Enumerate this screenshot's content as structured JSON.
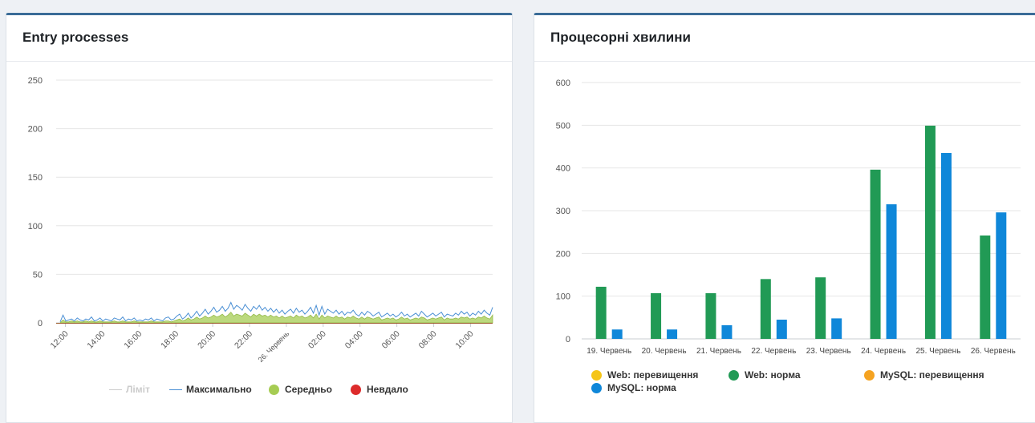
{
  "cards": {
    "left_title": "Entry processes",
    "right_title": "Процесорні хвилини"
  },
  "colors": {
    "limit": "#cccccc",
    "max": "#4a8fd4",
    "avg": "#a6cc53",
    "fail": "#dd2b2b",
    "web_over": "#f5c518",
    "web_norm": "#219a55",
    "mysql_over": "#f5a321",
    "mysql_norm": "#0f87d9"
  },
  "chart_data": [
    {
      "type": "area",
      "title": "Entry processes",
      "ylim": [
        0,
        250
      ],
      "y_ticks": [
        0,
        50,
        100,
        150,
        200,
        250
      ],
      "x_tick_labels": [
        "12:00",
        "14:00",
        "16:00",
        "18:00",
        "20:00",
        "22:00",
        "26. Червень",
        "02:00",
        "04:00",
        "06:00",
        "08:00",
        "10:00"
      ],
      "x_hours_range": [
        11.5,
        35.2
      ],
      "x_tick_hours": [
        12,
        14,
        16,
        18,
        20,
        22,
        24,
        26,
        28,
        30,
        32,
        34
      ],
      "grid": true,
      "legend_position": "bottom",
      "series": [
        {
          "name": "Ліміт",
          "style": "line",
          "visible": false,
          "values": []
        },
        {
          "name": "Максимально",
          "style": "line",
          "values": [
            1,
            8,
            2,
            3,
            4,
            2,
            5,
            3,
            2,
            4,
            3,
            6,
            2,
            3,
            5,
            2,
            4,
            3,
            2,
            5,
            4,
            3,
            6,
            2,
            4,
            3,
            5,
            2,
            3,
            2,
            4,
            3,
            5,
            2,
            4,
            3,
            2,
            5,
            6,
            3,
            4,
            7,
            9,
            4,
            6,
            10,
            5,
            8,
            12,
            7,
            10,
            14,
            9,
            12,
            16,
            11,
            13,
            17,
            12,
            15,
            21,
            14,
            18,
            16,
            13,
            19,
            15,
            12,
            17,
            14,
            18,
            13,
            16,
            12,
            15,
            11,
            14,
            10,
            13,
            9,
            12,
            14,
            10,
            15,
            11,
            13,
            9,
            12,
            16,
            10,
            18,
            8,
            17,
            9,
            14,
            12,
            10,
            13,
            9,
            12,
            8,
            11,
            10,
            13,
            9,
            7,
            11,
            8,
            12,
            10,
            7,
            9,
            11,
            6,
            8,
            10,
            7,
            9,
            6,
            8,
            11,
            7,
            9,
            6,
            8,
            10,
            7,
            12,
            9,
            6,
            8,
            10,
            7,
            9,
            11,
            6,
            9,
            8,
            7,
            10,
            8,
            12,
            9,
            11,
            7,
            10,
            8,
            12,
            9,
            13,
            10,
            8,
            16
          ]
        },
        {
          "name": "Середньо",
          "style": "area",
          "values": [
            0,
            3,
            1,
            1,
            2,
            1,
            2,
            1,
            1,
            2,
            1,
            2,
            1,
            1,
            2,
            1,
            1,
            1,
            1,
            2,
            1,
            1,
            2,
            1,
            1,
            1,
            2,
            1,
            1,
            1,
            1,
            1,
            2,
            1,
            1,
            1,
            1,
            2,
            2,
            1,
            2,
            3,
            4,
            2,
            3,
            5,
            3,
            4,
            6,
            4,
            5,
            7,
            5,
            6,
            8,
            6,
            7,
            9,
            6,
            8,
            11,
            7,
            9,
            8,
            7,
            10,
            8,
            6,
            9,
            7,
            9,
            7,
            8,
            6,
            8,
            6,
            7,
            5,
            7,
            5,
            6,
            7,
            5,
            8,
            6,
            7,
            5,
            6,
            8,
            5,
            9,
            4,
            8,
            5,
            7,
            6,
            5,
            7,
            5,
            6,
            4,
            6,
            5,
            7,
            5,
            4,
            6,
            4,
            6,
            5,
            4,
            5,
            6,
            3,
            4,
            5,
            4,
            5,
            3,
            4,
            6,
            4,
            5,
            3,
            4,
            5,
            4,
            6,
            5,
            3,
            4,
            5,
            4,
            5,
            6,
            3,
            5,
            4,
            4,
            5,
            4,
            6,
            5,
            6,
            4,
            5,
            4,
            6,
            5,
            7,
            5,
            4,
            8
          ]
        },
        {
          "name": "Невдало",
          "style": "area",
          "values": []
        }
      ]
    },
    {
      "type": "bar",
      "title": "Процесорні хвилини",
      "ylim": [
        0,
        600
      ],
      "y_ticks": [
        0,
        100,
        200,
        300,
        400,
        500,
        600
      ],
      "categories": [
        "19. Червень",
        "20. Червень",
        "21. Червень",
        "22. Червень",
        "23. Червень",
        "24. Червень",
        "25. Червень",
        "26. Червень"
      ],
      "grid": true,
      "legend_position": "bottom",
      "series": [
        {
          "name": "Web: перевищення",
          "values": [
            0,
            0,
            0,
            0,
            0,
            0,
            0,
            0
          ]
        },
        {
          "name": "Web: норма",
          "values": [
            122,
            107,
            107,
            140,
            144,
            396,
            499,
            242
          ]
        },
        {
          "name": "MySQL: перевищення",
          "values": [
            0,
            0,
            0,
            0,
            0,
            0,
            0,
            0
          ]
        },
        {
          "name": "MySQL: норма",
          "values": [
            22,
            22,
            32,
            45,
            48,
            315,
            435,
            296
          ]
        }
      ]
    }
  ]
}
